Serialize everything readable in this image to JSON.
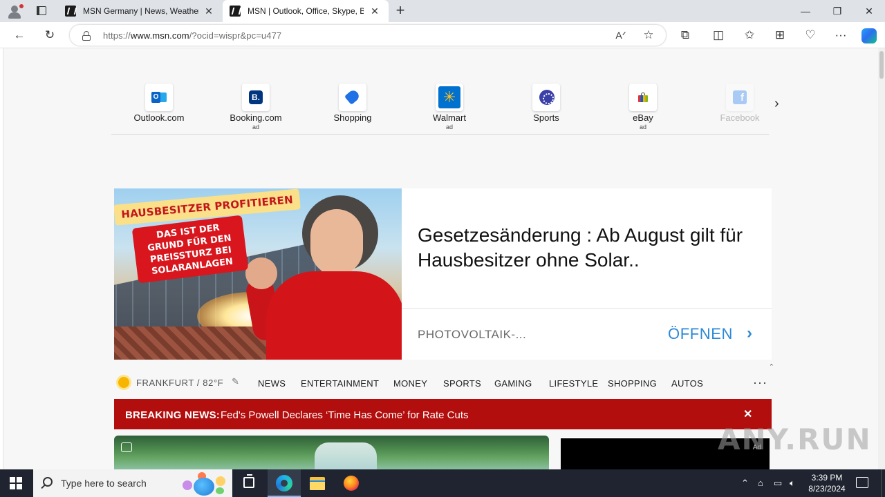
{
  "browser": {
    "tabs": [
      {
        "title": "MSN Germany | News, Weather,",
        "active": false
      },
      {
        "title": "MSN | Outlook, Office, Skype, Bi",
        "active": true
      }
    ],
    "url_prefix": "https://",
    "url_domain": "www.msn.com",
    "url_path": "/?ocid=wispr&pc=u477",
    "window_controls": {
      "minimize": "—",
      "restore": "❐",
      "close": "✕"
    }
  },
  "quicklinks": [
    {
      "label": "Outlook.com",
      "ad": "",
      "icon": "outlook-icon"
    },
    {
      "label": "Booking.com",
      "ad": "ad",
      "icon": "booking-icon"
    },
    {
      "label": "Shopping",
      "ad": "",
      "icon": "shopping-tag-icon"
    },
    {
      "label": "Walmart",
      "ad": "ad",
      "icon": "walmart-icon"
    },
    {
      "label": "Sports",
      "ad": "",
      "icon": "sports-icon"
    },
    {
      "label": "eBay",
      "ad": "ad",
      "icon": "ebay-icon"
    },
    {
      "label": "Facebook",
      "ad": "",
      "icon": "facebook-icon"
    }
  ],
  "ad_banner": {
    "image_tag_top": "HAUSBESITZER PROFITIEREN",
    "image_tag_main": "DAS IST DER GRUND FÜR DEN PREISSTURZ BEI SOLARANLAGEN",
    "headline": "Gesetzesänderung : Ab August gilt für Hausbesitzer ohne Solar..",
    "source": "PHOTOVOLTAIK-...",
    "cta": "ÖFFNEN"
  },
  "weather": {
    "text": "FRANKFURT / 82°F"
  },
  "nav_links": [
    "NEWS",
    "ENTERTAINMENT",
    "MONEY",
    "SPORTS",
    "GAMING",
    "LIFESTYLE",
    "SHOPPING",
    "AUTOS"
  ],
  "nav_more": "···",
  "breaking": {
    "label": "BREAKING NEWS:",
    "headline": "Fed's Powell Declares ‘Time Has Come’ for Rate Cuts",
    "close": "✕"
  },
  "cards": {
    "right_ad": "Ad"
  },
  "watermark": "ANY.RUN",
  "taskbar": {
    "search_placeholder": "Type here to search",
    "time": "3:39 PM",
    "date": "8/23/2024"
  },
  "colors": {
    "breaking_bg": "#b30e0e",
    "cta": "#2b88d8",
    "taskbar_bg": "#1f2430"
  }
}
